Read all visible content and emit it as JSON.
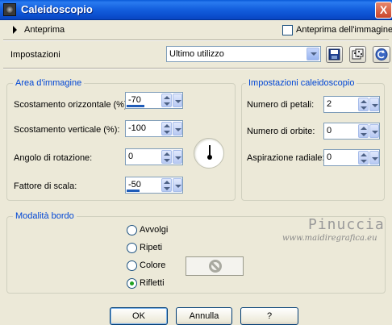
{
  "window": {
    "title": "Caleidoscopio",
    "close_label": "X"
  },
  "preview": {
    "label": "Anteprima",
    "image_preview_label": "Anteprima dell'immagine",
    "image_preview_checked": false
  },
  "presets": {
    "label": "Impostazioni",
    "value": "Ultimo utilizzo"
  },
  "area": {
    "title": "Area d'immagine",
    "h_offset_label": "Scostamento orizzontale (%):",
    "h_offset_value": "-70",
    "v_offset_label": "Scostamento verticale (%):",
    "v_offset_value": "-100",
    "rotation_label": "Angolo di rotazione:",
    "rotation_value": "0",
    "scale_label": "Fattore di scala:",
    "scale_value": "-50"
  },
  "kaleido": {
    "title": "Impostazioni caleidoscopio",
    "petals_label": "Numero di petali:",
    "petals_value": "2",
    "orbits_label": "Numero di orbite:",
    "orbits_value": "0",
    "radial_label": "Aspirazione radiale:",
    "radial_value": "0"
  },
  "edge": {
    "title": "Modalità bordo",
    "options": [
      "Avvolgi",
      "Ripeti",
      "Colore",
      "Rifletti"
    ],
    "selected": "Rifletti"
  },
  "watermark": {
    "line1": "Pinuccia",
    "line2": "www.maidiregrafica.eu"
  },
  "buttons": {
    "ok": "OK",
    "cancel": "Annulla",
    "help": "?"
  },
  "colors": {
    "title_bar": "#0a50d0",
    "group_title": "#0046d5",
    "selected_radio": "#21a121"
  }
}
